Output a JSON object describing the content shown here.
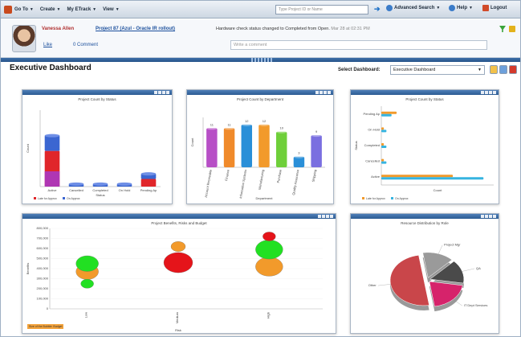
{
  "menubar": {
    "items": [
      {
        "label": "Go To",
        "icon": "chevron-down"
      },
      {
        "label": "Create",
        "icon": "chevron-down"
      },
      {
        "label": "My ETrack",
        "icon": "chevron-down"
      },
      {
        "label": "View",
        "icon": "chevron-down"
      }
    ],
    "search_placeholder": "Type Project ID or Name",
    "advanced_search": "Advanced Search",
    "help": "Help",
    "logout": "Logout"
  },
  "activity": {
    "user_name": "Vanessa Allen",
    "project_link": "Project 87 (Azul - Oracle IR rollout)",
    "status_message": "Hardware check status changed to Completed from Open.",
    "timestamp": "Mar 28 at 02:31 PM",
    "like": "Like",
    "comment_count": "0 Comment",
    "write_comment_placeholder": "Write a comment"
  },
  "header": {
    "title": "Executive Dashboard",
    "select_label": "Select Dashboard:",
    "select_value": "Executive Dashboard"
  },
  "colors": {
    "menubar": "#cdd7e3",
    "panel_bar": "#2c5b93",
    "accent_blue": "#3b66d1",
    "red": "#e0262a",
    "purple": "#a33bd6",
    "orange": "#f29a2b",
    "green": "#2ecc2e",
    "cyan": "#36b4e0"
  },
  "charts": {
    "status_bar": {
      "title": "Project Count by Status",
      "legend": [
        "Late for Approx",
        "On Approx"
      ]
    },
    "dept_bar": {
      "title": "Project Count by Department"
    },
    "status_hbar": {
      "title": "Project Count by Status"
    },
    "bubble": {
      "title": "Project Benefits, Risks and Budget",
      "budget_note": "Size of the Bubble: Budget"
    },
    "pie": {
      "title": "Resource Distribution by Role"
    }
  },
  "chart_data": [
    {
      "type": "bar",
      "categories": [
        "Active",
        "Cancelled",
        "Completed",
        "On Hold",
        "Pending Ap"
      ],
      "series": [
        {
          "name": "Late for Approx",
          "values": [
            14,
            0,
            0,
            0,
            3
          ]
        },
        {
          "name": "On Approx",
          "values": [
            6,
            1,
            1,
            1,
            2
          ]
        }
      ],
      "stacked": true,
      "xlabel": "Status",
      "ylabel": "Count",
      "ylim": [
        0,
        30
      ]
    },
    {
      "type": "bar",
      "categories": [
        "Account Receivable",
        "Finance",
        "Information Systems",
        "Manufacturing",
        "Purchase",
        "Quality Assurance",
        "Shipping"
      ],
      "values": [
        11,
        11,
        12,
        12,
        10,
        3,
        9
      ],
      "xlabel": "Department",
      "ylabel": "Count",
      "ylim": [
        0,
        14
      ]
    },
    {
      "type": "bar",
      "orientation": "horizontal",
      "categories": [
        "Pending Ap",
        "On Hold",
        "Completed",
        "Cancelled",
        "Active"
      ],
      "series": [
        {
          "name": "Late for Approx",
          "values": [
            3,
            0.5,
            0.5,
            0.5,
            14
          ]
        },
        {
          "name": "On Approx",
          "values": [
            2,
            1,
            1,
            1,
            20
          ]
        }
      ],
      "xlabel": "Count",
      "ylabel": "Status",
      "xlim": [
        0,
        22
      ]
    },
    {
      "type": "scatter",
      "categories": [
        "Low",
        "Medium",
        "High"
      ],
      "series": [
        {
          "name": "green",
          "points": [
            {
              "x": "Low",
              "y": 450000
            },
            {
              "x": "Low",
              "y": 250000
            },
            {
              "x": "High",
              "y": 590000
            }
          ]
        },
        {
          "name": "orange",
          "points": [
            {
              "x": "Low",
              "y": 370000
            },
            {
              "x": "Medium",
              "y": 620000
            },
            {
              "x": "High",
              "y": 420000
            }
          ]
        },
        {
          "name": "red",
          "points": [
            {
              "x": "Medium",
              "y": 460000
            },
            {
              "x": "High",
              "y": 720000
            }
          ]
        }
      ],
      "xlabel": "Risk",
      "ylabel": "Benefits",
      "ylim": [
        0,
        800000
      ],
      "yticks": [
        "0",
        "100,000",
        "200,000",
        "300,000",
        "400,000",
        "500,000",
        "600,000",
        "700,000",
        "800,000"
      ]
    },
    {
      "type": "pie",
      "labels": [
        "Project Mgr",
        "QA",
        "IT Dept Services",
        "Other"
      ],
      "values": [
        15,
        15,
        20,
        50
      ],
      "colors": [
        "#9a9a9a",
        "#4a4a4a",
        "#d6236b",
        "#c9464a"
      ]
    }
  ]
}
